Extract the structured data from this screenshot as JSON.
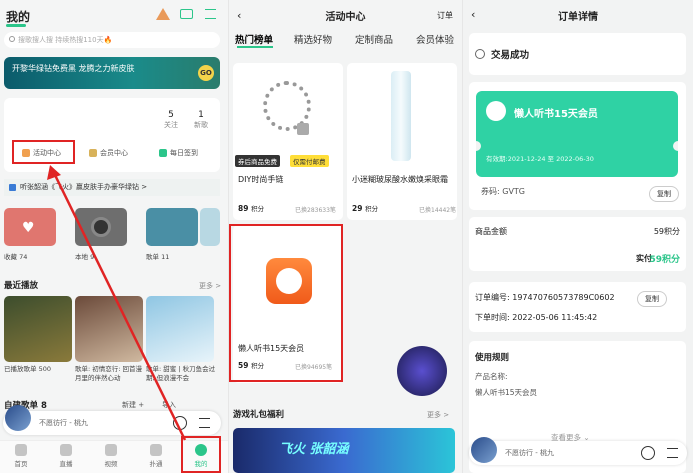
{
  "colors": {
    "accent": "#2bc58a",
    "highlight": "#e02424",
    "ticket": "#2fd2a4"
  },
  "p1": {
    "title": "我的",
    "search_placeholder": "搜歌搜人搜 持续热搜110天🔥",
    "banner_text": "开黎华绿钻免费黑 龙腾之力新皮肤",
    "banner_btn": "GO",
    "stat1_num": "5",
    "stat1_label": "关注",
    "stat2_num": "1",
    "stat2_label": "新歌",
    "quick": [
      "活动中心",
      "会员中心",
      "每日签到"
    ],
    "promo": "听张韶涵《飞火》赢皮肤手办豪华绿钻 >",
    "tiles": [
      "收藏 74",
      "本地 9",
      "歌单 11"
    ],
    "recent_title": "最近播放",
    "more": "更多 >",
    "recent": [
      "已播放歌单 500",
      "歌单: 初情恋行: 回首漫月里的伴然心动",
      "歌单: 甜蜜 | 秋刀鱼会过期, 但浪漫不会"
    ],
    "myplaylist": "自建歌单 8",
    "new_btn": "新建 +",
    "import_btn": "导入",
    "mini_song": "不愿彷行 - 桃九",
    "tabs": [
      "首页",
      "直播",
      "视频",
      "扑通",
      "我的"
    ]
  },
  "p2": {
    "title": "活动中心",
    "right": "订单",
    "tabs": [
      "热门榜单",
      "精选好物",
      "定制商品",
      "会员体验"
    ],
    "prod1": {
      "badge1": "券后商品免费",
      "badge2": "仅需付邮费",
      "name": "DIY时尚手链",
      "pts": "89",
      "pts_unit": "积分",
      "sold": "已换283633笔"
    },
    "prod2": {
      "name": "小迷糊玻尿酸水嫩焕采眼霜",
      "pts": "29",
      "pts_unit": "积分",
      "sold": "已换14442笔"
    },
    "prod3": {
      "name": "懒人听书15天会员",
      "pts": "59",
      "pts_unit": "积分",
      "sold": "已换94695笔"
    },
    "game_title": "游戏礼包福利",
    "game_more": "更多 >",
    "game_banner": "飞火 张韶涵"
  },
  "p3": {
    "title": "订单详情",
    "status": "交易成功",
    "ticket_name": "懒人听书15天会员",
    "validity": "有效期:2021-12-24 至 2022-06-30",
    "code_label": "券码:",
    "code": "GVTG",
    "copy": "复制",
    "amount_label": "商品金额",
    "amount": "59积分",
    "paid_label": "实付",
    "paid": "59积分",
    "order_no_label": "订单编号:",
    "order_no": "197470760573789C0602",
    "order_time_label": "下单时间:",
    "order_time": "2022-05-06 11:45:42",
    "rules_title": "使用规则",
    "rule_name_label": "产品名称:",
    "rule_name": "懒人听书15天会员",
    "more": "查看更多 ⌄",
    "mini_song": "不愿彷行 - 桃九"
  }
}
